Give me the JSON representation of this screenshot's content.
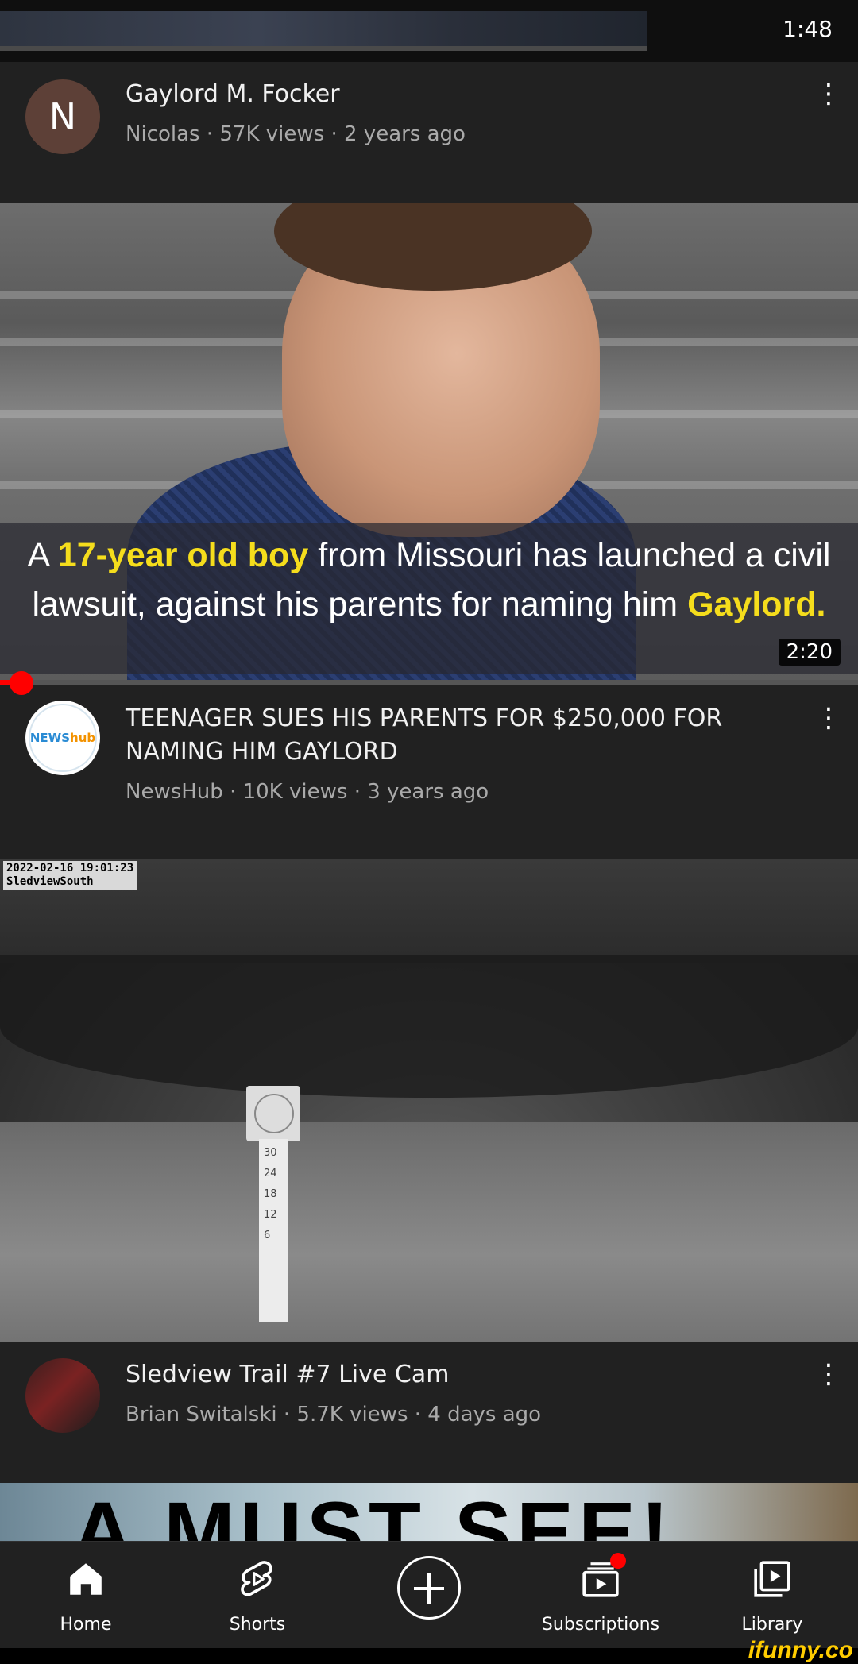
{
  "status": {
    "time": "1:48"
  },
  "videos": [
    {
      "avatar_letter": "N",
      "title": "Gaylord M. Focker",
      "channel": "Nicolas",
      "views": "57K views",
      "age": "2 years ago"
    },
    {
      "avatar_text_a": "NEWS",
      "avatar_text_b": "hub",
      "title": "TEENAGER SUES HIS PARENTS FOR $250,000 FOR NAMING HIM GAYLORD",
      "channel": "NewsHub",
      "views": "10K views",
      "age": "3 years ago",
      "duration": "2:20",
      "caption": {
        "p1": "A ",
        "h1": "17-year old boy",
        "p2": " from Missouri has launched a civil lawsuit, against his parents for naming him ",
        "h2": "Gaylord."
      },
      "watch_progress": 0.02
    },
    {
      "stamp_date": "2022-02-16 19:01:23",
      "stamp_place": "SledviewSouth",
      "ruler_marks": [
        "30",
        "24",
        "18",
        "12",
        "6"
      ],
      "title": "Sledview Trail #7 Live Cam",
      "channel": "Brian Switalski",
      "views": "5.7K views",
      "age": "4 days ago"
    },
    {
      "thumb_text": "A MUST SEE!"
    }
  ],
  "separator": "·",
  "nav": {
    "home": "Home",
    "shorts": "Shorts",
    "subscriptions": "Subscriptions",
    "library": "Library"
  },
  "icons": [
    "home-icon",
    "shorts-icon",
    "create-icon",
    "subscriptions-icon",
    "library-icon",
    "more-vert-icon"
  ],
  "colors": {
    "background": "#212121",
    "accent": "#ff0000",
    "highlight": "#f5dd1c",
    "secondary_text": "#aaaaaa"
  },
  "watermark": "ifunny.co"
}
